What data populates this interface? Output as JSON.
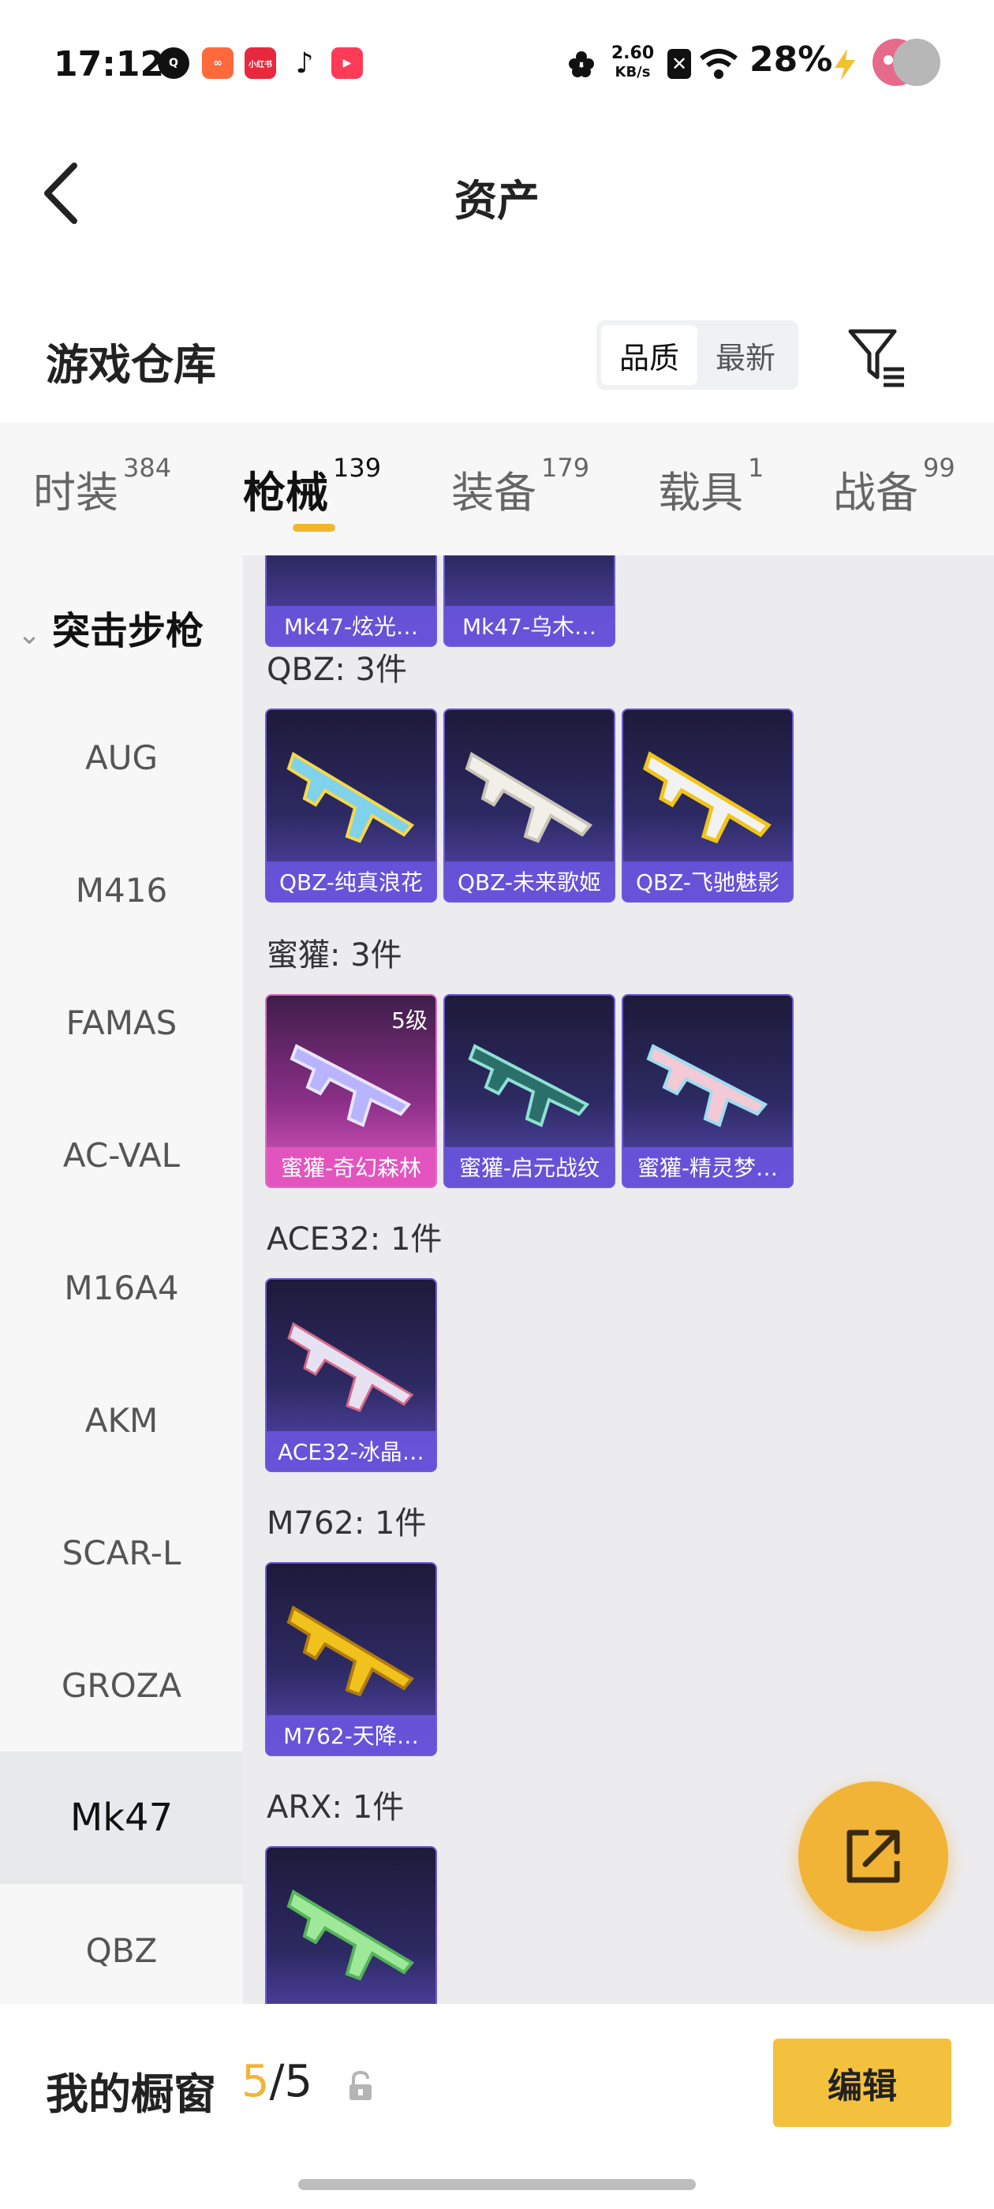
{
  "status_bar": {
    "time": "17:12",
    "app_icons": [
      "q-icon",
      "kuaishou-icon",
      "xiaohongshu-icon",
      "tiktok-icon",
      "video-app-icon"
    ],
    "net_speed_value": "2.60",
    "net_speed_unit": "KB/s",
    "battery": "28%"
  },
  "header": {
    "title": "资产",
    "back_icon": "chevron-left-icon"
  },
  "warehouse": {
    "title": "游戏仓库",
    "sort_options": [
      "品质",
      "最新"
    ],
    "selected_sort": "品质",
    "filter_icon": "filter-icon"
  },
  "tabs": [
    {
      "label": "时装",
      "count": "384",
      "active": false
    },
    {
      "label": "枪械",
      "count": "139",
      "active": true
    },
    {
      "label": "装备",
      "count": "179",
      "active": false
    },
    {
      "label": "载具",
      "count": "1",
      "active": false
    },
    {
      "label": "战备",
      "count": "99",
      "active": false
    }
  ],
  "sidebar": {
    "category": "突击步枪",
    "items": [
      {
        "label": "AUG",
        "active": false
      },
      {
        "label": "M416",
        "active": false
      },
      {
        "label": "FAMAS",
        "active": false
      },
      {
        "label": "AC-VAL",
        "active": false
      },
      {
        "label": "M16A4",
        "active": false
      },
      {
        "label": "AKM",
        "active": false
      },
      {
        "label": "SCAR-L",
        "active": false
      },
      {
        "label": "GROZA",
        "active": false
      },
      {
        "label": "Mk47",
        "active": true
      },
      {
        "label": "QBZ",
        "active": false
      }
    ]
  },
  "groups": [
    {
      "title": "",
      "items": [
        {
          "name": "Mk47-炫光…",
          "level": ""
        },
        {
          "name": "Mk47-乌木…",
          "level": ""
        }
      ]
    },
    {
      "title": "QBZ: 3件",
      "items": [
        {
          "name": "QBZ-纯真浪花",
          "level": ""
        },
        {
          "name": "QBZ-未来歌姬",
          "level": ""
        },
        {
          "name": "QBZ-飞驰魅影",
          "level": ""
        }
      ]
    },
    {
      "title": "蜜獾: 3件",
      "items": [
        {
          "name": "蜜獾-奇幻森林",
          "level": "5级"
        },
        {
          "name": "蜜獾-启元战纹",
          "level": ""
        },
        {
          "name": "蜜獾-精灵梦…",
          "level": ""
        }
      ]
    },
    {
      "title": "ACE32: 1件",
      "items": [
        {
          "name": "ACE32-冰晶…",
          "level": ""
        }
      ]
    },
    {
      "title": "M762: 1件",
      "items": [
        {
          "name": "M762-天降…",
          "level": ""
        }
      ]
    },
    {
      "title": "ARX: 1件",
      "items": [
        {
          "name": "",
          "level": ""
        }
      ]
    }
  ],
  "colors": {
    "accent": "#f1b436",
    "card_purple": "#6e5ad8",
    "card_pink": "#e26cc6"
  },
  "fab_icon": "share-external-icon",
  "showcase": {
    "label": "我的橱窗",
    "current": "5",
    "sep": "/",
    "total": "5",
    "lock_icon": "lock-icon",
    "edit_label": "编辑"
  }
}
